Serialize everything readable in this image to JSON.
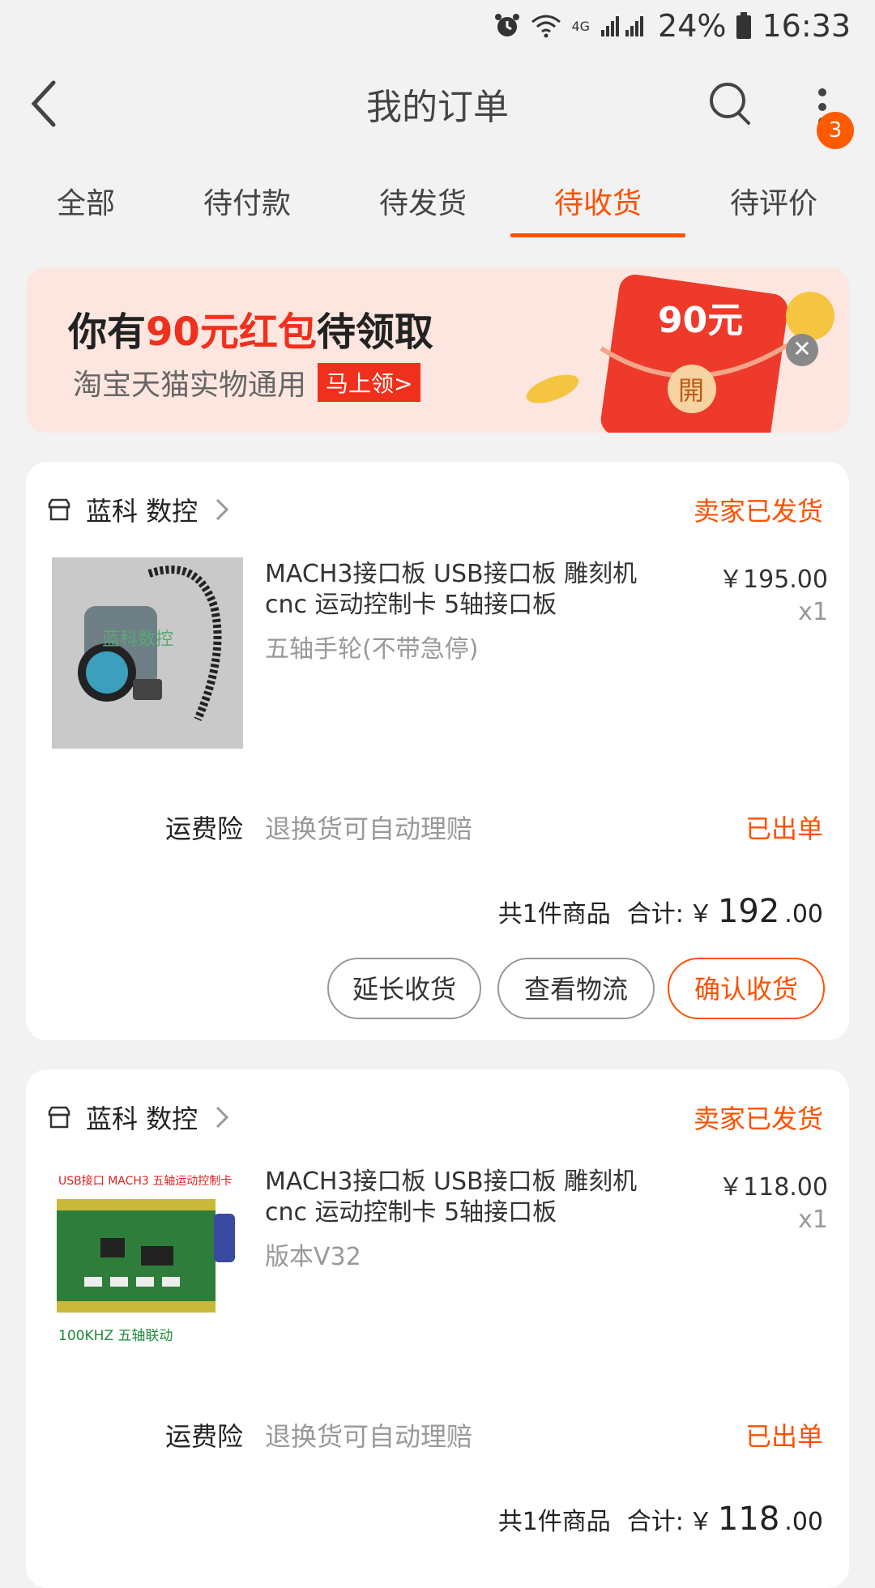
{
  "status_bar": {
    "battery": "24%",
    "time": "16:33",
    "network": "4G"
  },
  "header": {
    "title": "我的订单",
    "badge_count": "3"
  },
  "tabs": [
    {
      "label": "全部"
    },
    {
      "label": "待付款"
    },
    {
      "label": "待发货"
    },
    {
      "label": "待收货",
      "active": true
    },
    {
      "label": "待评价"
    }
  ],
  "banner": {
    "text_prefix": "你有",
    "amount": "90元红包",
    "text_suffix": "待领取",
    "sub": "淘宝天猫实物通用",
    "claim": "马上领>",
    "envelope_label": "90元",
    "envelope_seal": "開"
  },
  "orders": [
    {
      "shop": "蓝科 数控",
      "status": "卖家已发货",
      "title": "MACH3接口板 USB接口板 雕刻机 cnc 运动控制卡 5轴接口板",
      "sku": "五轴手轮(不带急停)",
      "price": "￥195.00",
      "qty": "x1",
      "image_text": "蓝科数控",
      "insurance_label": "运费险",
      "insurance_desc": "退换货可自动理赔",
      "insurance_status": "已出单",
      "total_count": "共1件商品",
      "total_label": "合计:",
      "total_currency": "￥",
      "total_int": "192",
      "total_dec": ".00",
      "buttons": [
        "延长收货",
        "查看物流",
        "确认收货"
      ]
    },
    {
      "shop": "蓝科 数控",
      "status": "卖家已发货",
      "title": "MACH3接口板 USB接口板 雕刻机 cnc 运动控制卡 5轴接口板",
      "sku": "版本V32",
      "price": "￥118.00",
      "qty": "x1",
      "image_top_text": "USB接口 MACH3 五轴运动控制卡",
      "image_bottom_text": "100KHZ 五轴联动",
      "insurance_label": "运费险",
      "insurance_desc": "退换货可自动理赔",
      "insurance_status": "已出单",
      "total_count": "共1件商品",
      "total_label": "合计:",
      "total_currency": "￥",
      "total_int": "118",
      "total_dec": ".00"
    }
  ],
  "colors": {
    "accent": "#ff5000",
    "red": "#f0301c",
    "banner_bg": "#fde6df"
  },
  "icons": [
    "alarm-icon",
    "wifi-icon",
    "signal-icon",
    "battery-icon",
    "back-icon",
    "search-icon",
    "more-icon",
    "shop-icon",
    "chevron-right-icon",
    "close-icon"
  ]
}
